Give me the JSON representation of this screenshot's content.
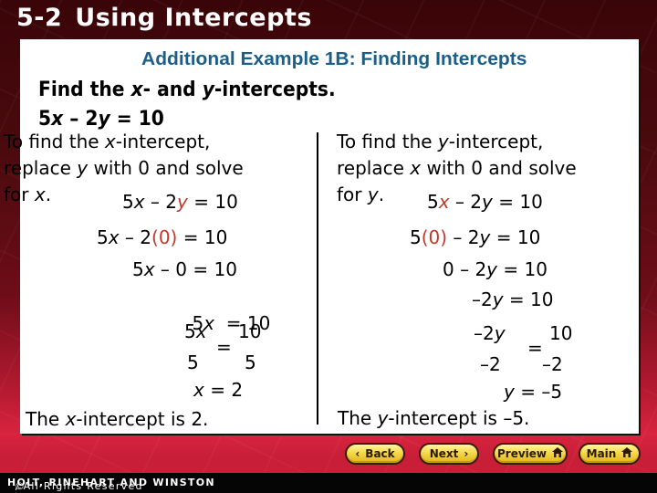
{
  "header": {
    "lesson_number": "5-2",
    "lesson_title": "Using Intercepts"
  },
  "slide": {
    "subtitle": "Additional Example 1B: Finding Intercepts",
    "prompt": {
      "pre": "Find the ",
      "x": "x",
      "mid": "- and ",
      "y": "y",
      "post": "-intercepts."
    },
    "equation": {
      "a": "5",
      "x": "x",
      "op": " – 2",
      "y": "y",
      "rhs": " = 10"
    },
    "left": {
      "line1_pre": "To find the ",
      "line1_var": "x",
      "line1_post": "-intercept,",
      "line2_pre": "replace ",
      "line2_var": "y",
      "line2_post": " with 0 and solve",
      "line3_pre": "for ",
      "line3_var": "x",
      "line3_post": ".",
      "step1": {
        "a": "5",
        "x": "x",
        "mid": " – 2",
        "y": "y",
        "rhs": " = 10"
      },
      "step2": {
        "a": "5",
        "x": "x",
        "mid": " – 2",
        "sub": "(0)",
        "rhs": " = 10"
      },
      "step3": {
        "a": "5",
        "x": "x",
        "rhs": " – 0 = 10"
      },
      "step4": {
        "a": "5",
        "x": "x",
        "rhs": "  = 10"
      },
      "frac": {
        "num_left": "5",
        "num_left_var": "x",
        "den_left": "5",
        "eq": "=",
        "num_right": "10",
        "den_right": "5"
      },
      "result": {
        "x": "x",
        "rhs": " = 2"
      },
      "conclusion_pre": "The ",
      "conclusion_var": "x",
      "conclusion_post": "-intercept is 2."
    },
    "right": {
      "line1_pre": "To find the ",
      "line1_var": "y",
      "line1_post": "-intercept,",
      "line2_pre": "replace ",
      "line2_var": "x",
      "line2_post": " with 0 and solve",
      "line3_pre": "for ",
      "line3_var": "y",
      "line3_post": ".",
      "step1": {
        "a": "5",
        "x": "x",
        "mid": " – 2",
        "y": "y",
        "rhs": " = 10"
      },
      "step2": {
        "a": "5",
        "sub": "(0)",
        "mid": " – 2",
        "y": "y",
        "rhs": " = 10"
      },
      "step3": {
        "lhs": "0 – 2",
        "y": "y",
        "rhs": " = 10"
      },
      "step4": {
        "lhs": "–2",
        "y": "y",
        "rhs": " = 10"
      },
      "frac": {
        "num_left": "–2",
        "num_left_var": "y",
        "den_left": "–2",
        "eq": "=",
        "num_right": "10",
        "den_right": "–2"
      },
      "result": {
        "y": "y",
        "rhs": " = –5"
      },
      "conclusion_pre": "The ",
      "conclusion_var": "y",
      "conclusion_post": "-intercept is –5."
    }
  },
  "nav": {
    "back_label": "Back",
    "back_icon": "chevron-left-icon",
    "next_label": "Next",
    "next_icon": "chevron-right-icon",
    "preview_label": "Preview",
    "preview_icon": "home-icon",
    "main_label": "Main",
    "main_icon": "home-icon"
  },
  "footer": {
    "copyright_symbol": "©",
    "publisher": "HOLT, RINEHART AND WINSTON",
    "rights": ", All Rights Reserved"
  },
  "colors": {
    "subtitle": "#1a5f8a",
    "highlight": "#c0392b",
    "header_bg": "#4a0a0e",
    "button_yellow": "#f6d84a"
  }
}
